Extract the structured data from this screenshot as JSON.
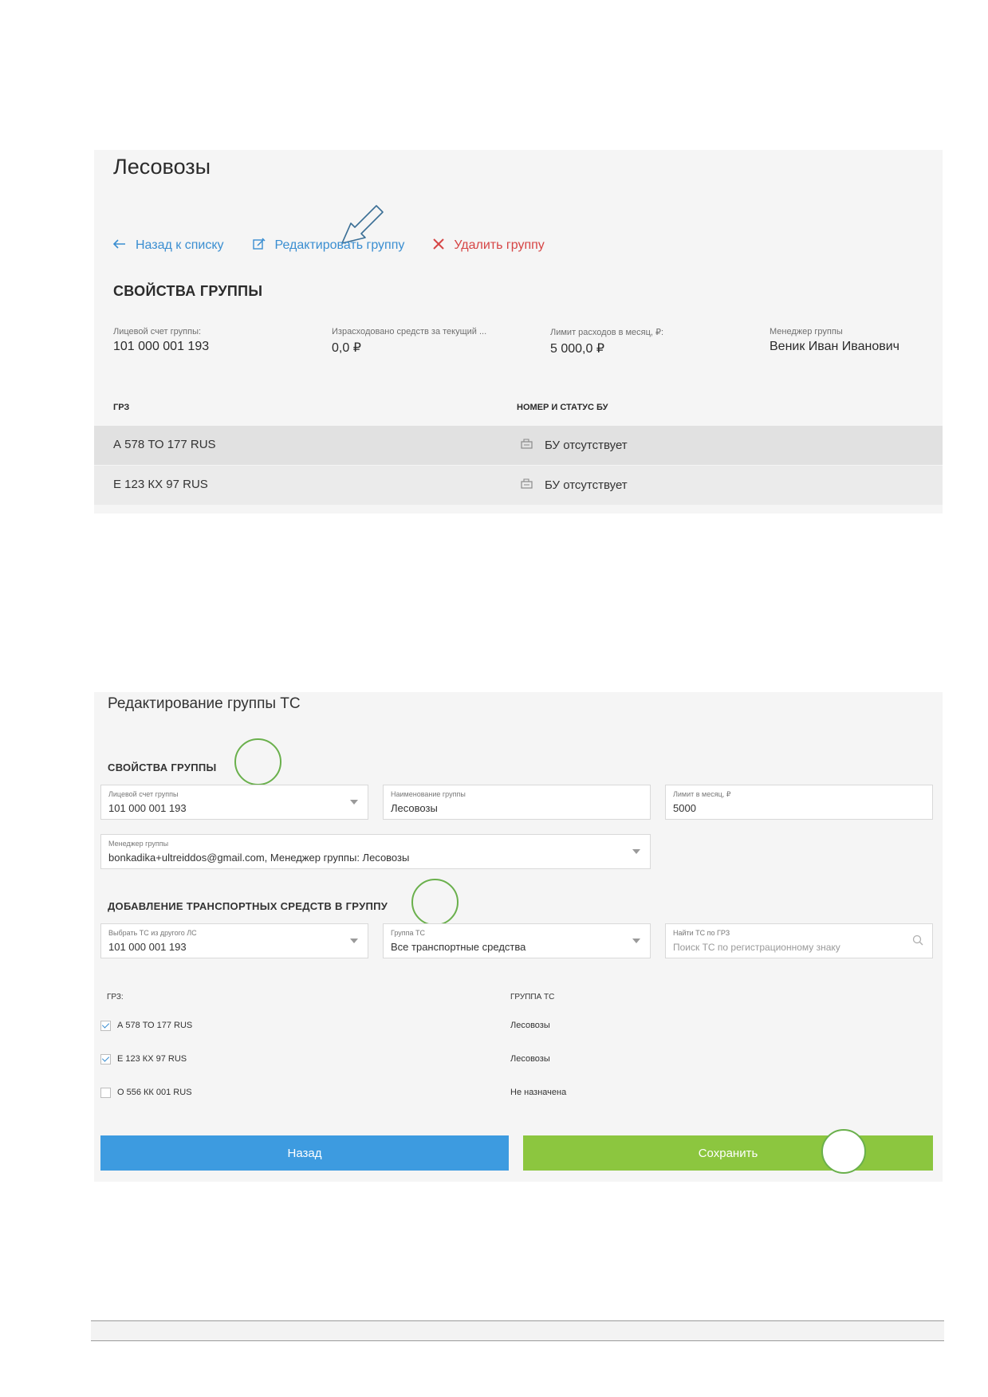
{
  "group_view": {
    "title": "Лесовозы",
    "actions": {
      "back": "Назад к списку",
      "edit": "Редактировать группу",
      "delete": "Удалить группу"
    },
    "section_title": "СВОЙСТВА ГРУППЫ",
    "properties": [
      {
        "label": "Лицевой счет группы:",
        "value": "101 000 001 193"
      },
      {
        "label": "Израсходовано средств за текущий ...",
        "value": "0,0 ₽"
      },
      {
        "label": "Лимит расходов в месяц, ₽:",
        "value": "5 000,0 ₽"
      },
      {
        "label": "Менеджер группы",
        "value": "Веник Иван Иванович"
      }
    ],
    "table": {
      "columns": [
        "ГРЗ",
        "НОМЕР И СТАТУС БУ"
      ],
      "rows": [
        {
          "grz": "А 578 ТО 177 RUS",
          "bu": "БУ отсутствует"
        },
        {
          "grz": "Е 123 КХ 97 RUS",
          "bu": "БУ отсутствует"
        }
      ]
    }
  },
  "group_edit": {
    "title": "Редактирование группы ТС",
    "section_properties": "СВОЙСТВА ГРУППЫ",
    "fields": {
      "account": {
        "label": "Лицевой счет группы",
        "value": "101 000 001 193"
      },
      "name": {
        "label": "Наименование группы",
        "value": "Лесовозы"
      },
      "limit": {
        "label": "Лимит в месяц, ₽",
        "value": "5000"
      },
      "manager": {
        "label": "Менеджер группы",
        "value": "bonkadika+ultreiddos@gmail.com, Менеджер группы: Лесовозы"
      }
    },
    "section_add": "ДОБАВЛЕНИЕ ТРАНСПОРТНЫХ СРЕДСТВ В ГРУППУ",
    "filters": {
      "other_account": {
        "label": "Выбрать ТС из другого ЛС",
        "value": "101 000 001 193"
      },
      "vehicle_group": {
        "label": "Группа ТС",
        "value": "Все транспортные средства"
      },
      "search": {
        "label": "Найти ТС по ГРЗ",
        "placeholder": "Поиск ТС по регистрационному знаку"
      }
    },
    "list": {
      "columns": [
        "ГРЗ:",
        "ГРУППА ТС"
      ],
      "rows": [
        {
          "grz": "А 578 ТО 177 RUS",
          "group": "Лесовозы",
          "checked": true
        },
        {
          "grz": "Е 123 КХ 97 RUS",
          "group": "Лесовозы",
          "checked": true
        },
        {
          "grz": "О 556 КК 001 RUS",
          "group": "Не назначена",
          "checked": false
        }
      ]
    },
    "buttons": {
      "back": "Назад",
      "save": "Сохранить"
    },
    "colors": {
      "back": "#3d9be0",
      "save": "#8cc63f",
      "annotation": "#6ab04c",
      "link": "#3a8ed1",
      "danger": "#d64545"
    }
  }
}
